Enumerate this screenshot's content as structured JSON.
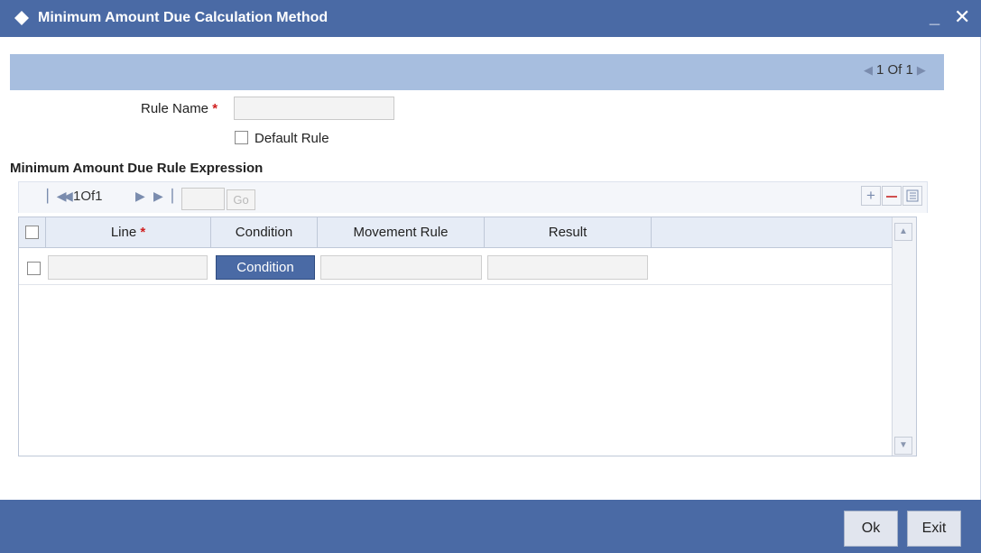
{
  "window": {
    "title": "Minimum Amount Due Calculation Method",
    "minimize": "_",
    "close": "✕"
  },
  "header": {
    "pager": "1 Of 1"
  },
  "form": {
    "rule_name_label": "Rule Name",
    "required_mark": "*",
    "rule_name_value": "",
    "default_rule_label": "Default Rule",
    "default_rule_checked": false
  },
  "section": {
    "title": "Minimum Amount Due Rule Expression"
  },
  "grid_toolbar": {
    "pages": "1Of1",
    "page_input": "",
    "go_label": "Go"
  },
  "grid": {
    "columns": [
      "Line",
      "Condition",
      "Movement Rule",
      "Result"
    ],
    "line_required_mark": "*",
    "rows": [
      {
        "line": "",
        "condition_button": "Condition",
        "movement_rule": "",
        "result": ""
      }
    ]
  },
  "footer": {
    "ok_label": "Ok",
    "exit_label": "Exit"
  },
  "colors": {
    "titlebar": "#4a6aa5",
    "band": "#a7bedf",
    "required": "#d02020"
  }
}
